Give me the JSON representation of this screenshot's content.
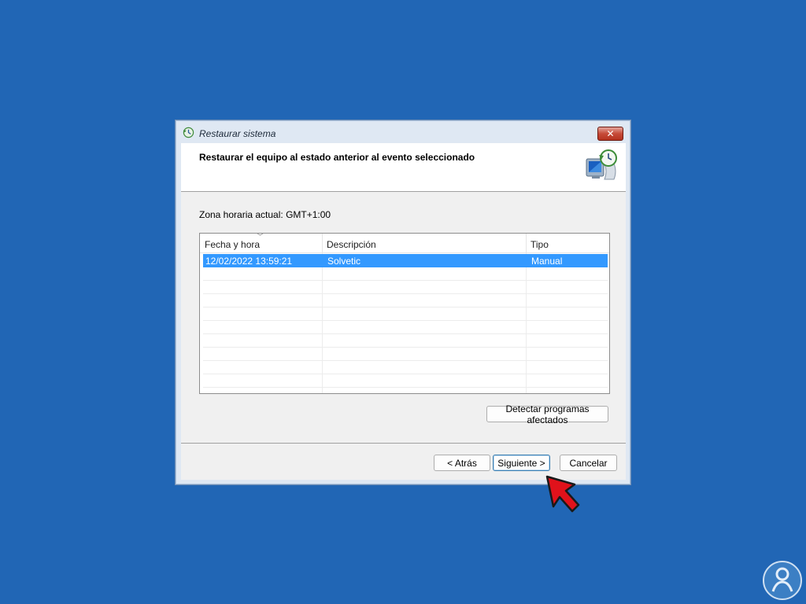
{
  "window": {
    "title": "Restaurar sistema",
    "close_label": "✕"
  },
  "header": {
    "title": "Restaurar el equipo al estado anterior al evento seleccionado"
  },
  "timezone": "Zona horaria actual: GMT+1:00",
  "table": {
    "columns": [
      "Fecha y hora",
      "Descripción",
      "Tipo"
    ],
    "rows": [
      {
        "date": "12/02/2022 13:59:21",
        "description": "Solvetic",
        "type": "Manual",
        "selected": true
      }
    ]
  },
  "buttons": {
    "detect": "Detectar programas afectados",
    "back": "< Atrás",
    "next": "Siguiente >",
    "cancel": "Cancelar"
  },
  "colors": {
    "desktop": "#2166b5",
    "selection": "#3399ff",
    "cursor": "#e0121b"
  }
}
